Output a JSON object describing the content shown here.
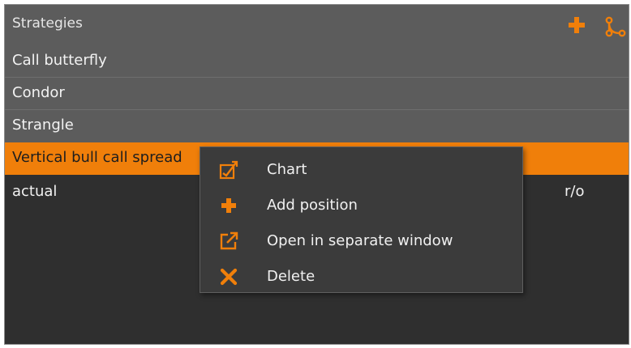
{
  "panel": {
    "title": "Strategies",
    "header_icons": [
      "plus-icon",
      "split-icon"
    ]
  },
  "strategies": [
    {
      "name": "Call butterfly"
    },
    {
      "name": "Condor"
    },
    {
      "name": "Strangle"
    },
    {
      "name": "Vertical bull call spread",
      "selected": true
    }
  ],
  "actual_row": {
    "name": "actual",
    "tag": "r/o"
  },
  "context_menu": {
    "items": [
      {
        "label": "Chart",
        "icon": "chart-icon"
      },
      {
        "label": "Add position",
        "icon": "plus-icon"
      },
      {
        "label": "Open in separate window",
        "icon": "external-window-icon"
      },
      {
        "label": "Delete",
        "icon": "close-icon"
      }
    ]
  },
  "colors": {
    "accent": "#f07f0a",
    "panel_bg": "#2f2f2f",
    "list_bg": "#5c5c5c",
    "menu_bg": "#3b3b3b"
  }
}
